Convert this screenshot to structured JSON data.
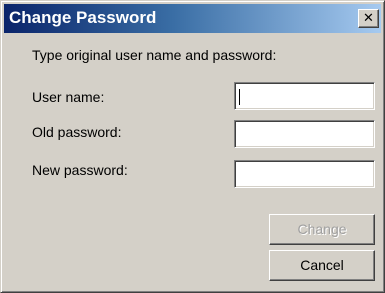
{
  "window": {
    "title": "Change Password",
    "close_glyph": "✕",
    "colors": {
      "titlebar_start": "#0a246a",
      "titlebar_end": "#a6caf0",
      "face": "#d4d0c8"
    }
  },
  "form": {
    "instruction": "Type original user name and password:",
    "user_name_label": "User name:",
    "user_name_value": "",
    "old_password_label": "Old password:",
    "old_password_value": "",
    "new_password_label": "New password:",
    "new_password_value": ""
  },
  "buttons": {
    "change_label": "Change",
    "change_enabled": false,
    "cancel_label": "Cancel"
  }
}
